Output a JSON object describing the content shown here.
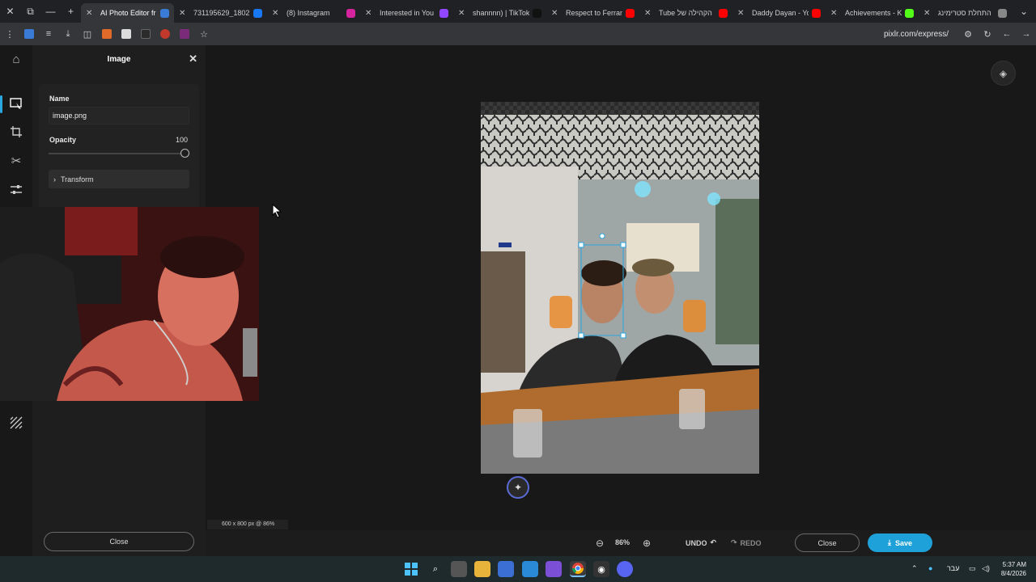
{
  "browser": {
    "tabs": [
      {
        "title": "AI Photo Editor fr",
        "favicon": "pixlr-icon",
        "color": "#3a7bd5",
        "active": true
      },
      {
        "title": "731195629_1802",
        "favicon": "facebook-icon",
        "color": "#1877f2",
        "active": false
      },
      {
        "title": "(8) Instagram",
        "favicon": "instagram-icon",
        "color": "#d6249f",
        "active": false
      },
      {
        "title": "Interested in You",
        "favicon": "app-icon",
        "color": "#9146ff",
        "active": false
      },
      {
        "title": "shannnn) | TikTok",
        "favicon": "tiktok-icon",
        "color": "#111111",
        "active": false
      },
      {
        "title": "Respect to Ferran",
        "favicon": "youtube-icon",
        "color": "#ff0000",
        "active": false
      },
      {
        "title": "Tube הקהילה של",
        "favicon": "youtube-icon",
        "color": "#ff0000",
        "active": false
      },
      {
        "title": "Daddy Dayan - Yo",
        "favicon": "youtube-icon",
        "color": "#ff0000",
        "active": false
      },
      {
        "title": "Achievements - K",
        "favicon": "kick-icon",
        "color": "#53fc18",
        "active": false
      },
      {
        "title": "התחלת סטרימינג",
        "favicon": "globe-icon",
        "color": "#888888",
        "active": false
      }
    ],
    "url": "pixlr.com/express/"
  },
  "panel": {
    "title": "Image",
    "name_label": "Name",
    "name_value": "image.png",
    "opacity_label": "Opacity",
    "opacity_value": "100",
    "transform_label": "Transform",
    "close_label": "Close"
  },
  "canvas": {
    "dims_text": "600 x 800 px @ 86%"
  },
  "bottom": {
    "zoom": "86%",
    "undo": "UNDO",
    "redo": "REDO",
    "close": "Close",
    "save": "Save"
  },
  "taskbar": {
    "lang": "עבר",
    "time": "5:37 AM",
    "date": "8/4/2026"
  },
  "colors": {
    "accent": "#1ea0d8",
    "workspace": "#181818"
  }
}
